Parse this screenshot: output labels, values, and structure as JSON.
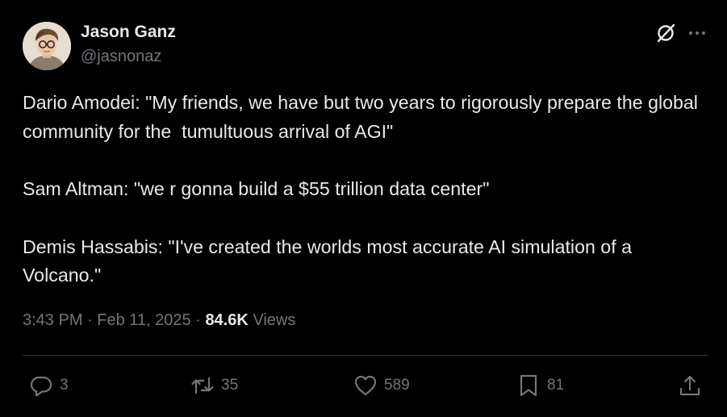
{
  "author": {
    "name": "Jason Ganz",
    "handle": "@jasnonaz"
  },
  "post": {
    "paragraphs": [
      "Dario Amodei: \"My friends, we have but two years to rigorously prepare the global community for the  tumultuous arrival of AGI\"",
      "Sam Altman: \"we r gonna build a $55 trillion data center\"",
      "Demis Hassabis: \"I've created the worlds most accurate AI simulation of a Volcano.\""
    ]
  },
  "meta": {
    "time": "3:43 PM",
    "separator": " · ",
    "date": "Feb 11, 2025",
    "views_count": "84.6K",
    "views_label": "Views"
  },
  "actions": {
    "replies": "3",
    "reposts": "35",
    "likes": "589",
    "bookmarks": "81"
  },
  "icons": {
    "top_right": [
      "grok-icon",
      "more-icon"
    ],
    "actions": [
      "reply-icon",
      "repost-icon",
      "like-icon",
      "bookmark-icon",
      "share-icon"
    ]
  },
  "colors": {
    "background": "#000000",
    "text_primary": "#e7e9ea",
    "text_secondary": "#71767b",
    "divider": "#2f3336"
  }
}
